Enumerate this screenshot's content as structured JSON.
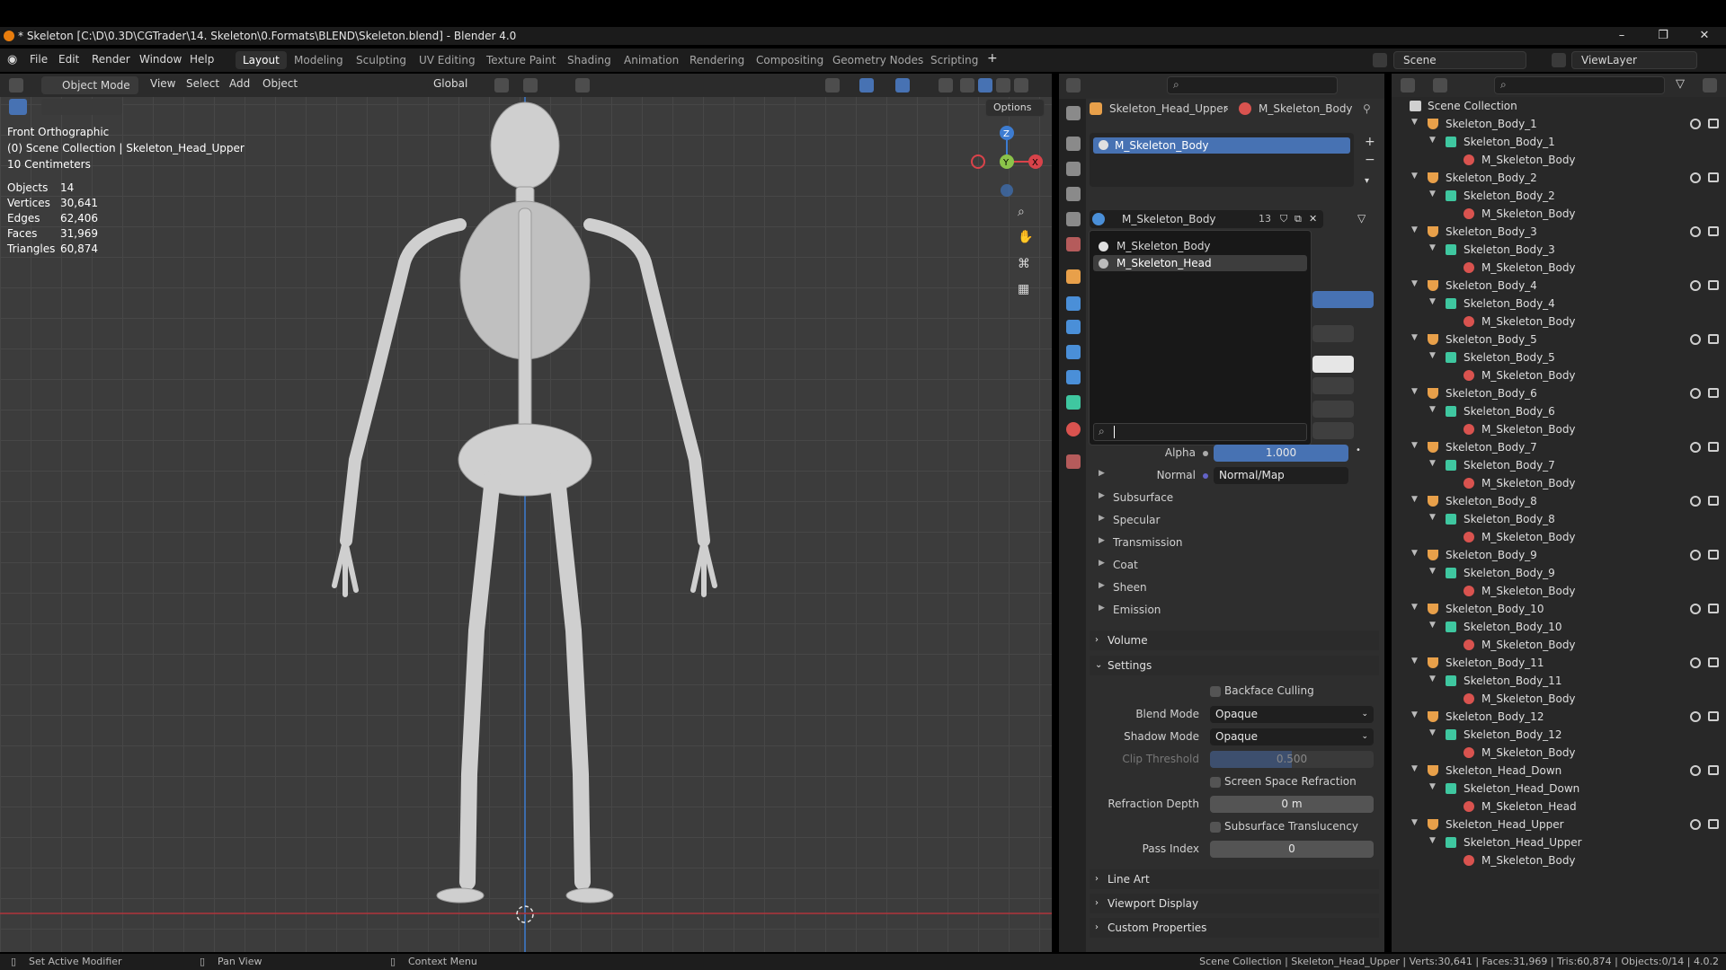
{
  "window": {
    "title": "* Skeleton [C:\\D\\0.3D\\CGTrader\\14. Skeleton\\0.Formats\\BLEND\\Skeleton.blend] - Blender 4.0",
    "minimize": "–",
    "maximize": "❐",
    "close": "✕"
  },
  "menu": {
    "items": [
      "File",
      "Edit",
      "Render",
      "Window",
      "Help"
    ],
    "workspaces": [
      "Layout",
      "Modeling",
      "Sculpting",
      "UV Editing",
      "Texture Paint",
      "Shading",
      "Animation",
      "Rendering",
      "Compositing",
      "Geometry Nodes",
      "Scripting"
    ],
    "add_tab": "+",
    "scene": "Scene",
    "view_layer": "ViewLayer"
  },
  "viewport": {
    "mode": "Object Mode",
    "menus": [
      "View",
      "Select",
      "Add",
      "Object"
    ],
    "orientation": "Global",
    "options": "Options",
    "view_name": "Front Orthographic",
    "collection_info": "(0) Scene Collection | Skeleton_Head_Upper",
    "scale": "10 Centimeters",
    "stats": [
      {
        "label": "Objects",
        "value": "14"
      },
      {
        "label": "Vertices",
        "value": "30,641"
      },
      {
        "label": "Edges",
        "value": "62,406"
      },
      {
        "label": "Faces",
        "value": "31,969"
      },
      {
        "label": "Triangles",
        "value": "60,874"
      }
    ],
    "gizmo": {
      "z": "Z",
      "y": "Y",
      "x": "X"
    }
  },
  "properties": {
    "breadcrumb_object": "Skeleton_Head_Upper",
    "breadcrumb_sep": "›",
    "breadcrumb_material": "M_Skeleton_Body",
    "slot_selected": "M_Skeleton_Body",
    "material_field": "M_Skeleton_Body",
    "user_count": "13",
    "popup_items": [
      "M_Skeleton_Body",
      "M_Skeleton_Head"
    ],
    "alpha_label": "Alpha",
    "alpha_value": "1.000",
    "normal_label": "Normal",
    "normal_value": "Normal/Map",
    "subpanels": [
      "Subsurface",
      "Specular",
      "Transmission",
      "Coat",
      "Sheen",
      "Emission"
    ],
    "volume": "Volume",
    "settings": "Settings",
    "backface_culling": "Backface Culling",
    "blend_mode_label": "Blend Mode",
    "blend_mode_value": "Opaque",
    "shadow_mode_label": "Shadow Mode",
    "shadow_mode_value": "Opaque",
    "clip_threshold_label": "Clip Threshold",
    "clip_threshold_value": "0.500",
    "ssr": "Screen Space Refraction",
    "refraction_depth_label": "Refraction Depth",
    "refraction_depth_value": "0 m",
    "subsurface_translucency": "Subsurface Translucency",
    "pass_index_label": "Pass Index",
    "pass_index_value": "0",
    "line_art": "Line Art",
    "viewport_display": "Viewport Display",
    "custom_properties": "Custom Properties"
  },
  "outliner": {
    "root": "Scene Collection",
    "rows": [
      {
        "level": 1,
        "text": "Skeleton_Body_1"
      },
      {
        "level": 2,
        "text": "Skeleton_Body_1"
      },
      {
        "level": 3,
        "text": "M_Skeleton_Body"
      },
      {
        "level": 1,
        "text": "Skeleton_Body_2"
      },
      {
        "level": 2,
        "text": "Skeleton_Body_2"
      },
      {
        "level": 3,
        "text": "M_Skeleton_Body"
      },
      {
        "level": 1,
        "text": "Skeleton_Body_3"
      },
      {
        "level": 2,
        "text": "Skeleton_Body_3"
      },
      {
        "level": 3,
        "text": "M_Skeleton_Body"
      },
      {
        "level": 1,
        "text": "Skeleton_Body_4"
      },
      {
        "level": 2,
        "text": "Skeleton_Body_4"
      },
      {
        "level": 3,
        "text": "M_Skeleton_Body"
      },
      {
        "level": 1,
        "text": "Skeleton_Body_5"
      },
      {
        "level": 2,
        "text": "Skeleton_Body_5"
      },
      {
        "level": 3,
        "text": "M_Skeleton_Body"
      },
      {
        "level": 1,
        "text": "Skeleton_Body_6"
      },
      {
        "level": 2,
        "text": "Skeleton_Body_6"
      },
      {
        "level": 3,
        "text": "M_Skeleton_Body"
      },
      {
        "level": 1,
        "text": "Skeleton_Body_7"
      },
      {
        "level": 2,
        "text": "Skeleton_Body_7"
      },
      {
        "level": 3,
        "text": "M_Skeleton_Body"
      },
      {
        "level": 1,
        "text": "Skeleton_Body_8"
      },
      {
        "level": 2,
        "text": "Skeleton_Body_8"
      },
      {
        "level": 3,
        "text": "M_Skeleton_Body"
      },
      {
        "level": 1,
        "text": "Skeleton_Body_9"
      },
      {
        "level": 2,
        "text": "Skeleton_Body_9"
      },
      {
        "level": 3,
        "text": "M_Skeleton_Body"
      },
      {
        "level": 1,
        "text": "Skeleton_Body_10"
      },
      {
        "level": 2,
        "text": "Skeleton_Body_10"
      },
      {
        "level": 3,
        "text": "M_Skeleton_Body"
      },
      {
        "level": 1,
        "text": "Skeleton_Body_11"
      },
      {
        "level": 2,
        "text": "Skeleton_Body_11"
      },
      {
        "level": 3,
        "text": "M_Skeleton_Body"
      },
      {
        "level": 1,
        "text": "Skeleton_Body_12"
      },
      {
        "level": 2,
        "text": "Skeleton_Body_12"
      },
      {
        "level": 3,
        "text": "M_Skeleton_Body"
      },
      {
        "level": 1,
        "text": "Skeleton_Head_Down"
      },
      {
        "level": 2,
        "text": "Skeleton_Head_Down"
      },
      {
        "level": 3,
        "text": "M_Skeleton_Head"
      },
      {
        "level": 1,
        "text": "Skeleton_Head_Upper"
      },
      {
        "level": 2,
        "text": "Skeleton_Head_Upper"
      },
      {
        "level": 3,
        "text": "M_Skeleton_Body"
      }
    ]
  },
  "status": {
    "left1": "Set Active Modifier",
    "left2": "Pan View",
    "left3": "Context Menu",
    "right": "Scene Collection | Skeleton_Head_Upper | Verts:30,641 | Faces:31,969 | Tris:60,874 | Objects:0/14 | 4.0.2"
  },
  "colors": {
    "accent": "#4772b3",
    "object_icon": "#e8a04a",
    "mesh_icon": "#3fc7a0",
    "material_icon": "#d9534f",
    "x_axis": "#d9434a",
    "y_axis": "#8bc34a",
    "z_axis": "#3d7cd1"
  }
}
